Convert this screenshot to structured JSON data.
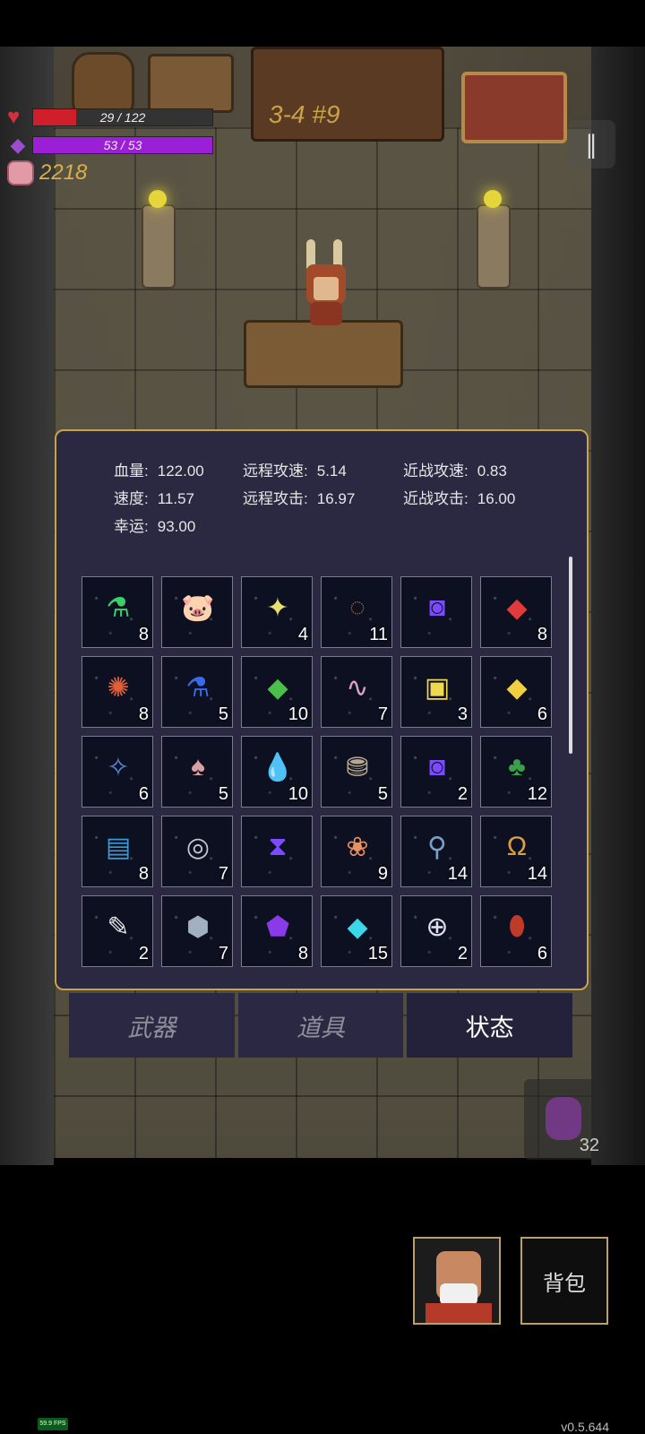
{
  "hud": {
    "hp": {
      "text": "29 / 122",
      "fraction": 0.24,
      "color": "#d01f2a"
    },
    "mana": {
      "text": "53 / 53",
      "fraction": 1.0,
      "color": "#9b1fd6"
    },
    "coins": "2218",
    "level": "3-4 #9"
  },
  "stats": [
    {
      "label": "血量:",
      "value": "122.00"
    },
    {
      "label": "远程攻速:",
      "value": "5.14"
    },
    {
      "label": "近战攻速:",
      "value": "0.83"
    },
    {
      "label": "速度:",
      "value": "11.57"
    },
    {
      "label": "远程攻击:",
      "value": "16.97"
    },
    {
      "label": "近战攻击:",
      "value": "16.00"
    },
    {
      "label": "幸运:",
      "value": "93.00"
    }
  ],
  "items": [
    {
      "icon": "green-potion-icon",
      "glyph": "⚗",
      "color": "#3ad16a",
      "count": "8"
    },
    {
      "icon": "piggy-bank-icon",
      "glyph": "🐷",
      "color": "#f0a0b8",
      "count": ""
    },
    {
      "icon": "star-crystal-icon",
      "glyph": "✦",
      "color": "#e8e070",
      "count": "4"
    },
    {
      "icon": "thorn-ring-icon",
      "glyph": "◌",
      "color": "#9a6a4a",
      "count": "11"
    },
    {
      "icon": "speed-rune-icon",
      "glyph": "◙",
      "color": "#7a4bff",
      "count": ""
    },
    {
      "icon": "red-crystal-icon",
      "glyph": "◆",
      "color": "#e03a3a",
      "count": "8"
    },
    {
      "icon": "spiky-skull-icon",
      "glyph": "✺",
      "color": "#e0603a",
      "count": "8"
    },
    {
      "icon": "blue-potion-icon",
      "glyph": "⚗",
      "color": "#3a6ae8",
      "count": "5"
    },
    {
      "icon": "green-crystal-icon",
      "glyph": "◆",
      "color": "#4ac04a",
      "count": "10"
    },
    {
      "icon": "worm-icon",
      "glyph": "∿",
      "color": "#e0a0c8",
      "count": "7"
    },
    {
      "icon": "yellow-card-icon",
      "glyph": "▣",
      "color": "#f0d850",
      "count": "3"
    },
    {
      "icon": "yellow-crystal-icon",
      "glyph": "◆",
      "color": "#f0d040",
      "count": "6"
    },
    {
      "icon": "dragonfly-icon",
      "glyph": "✧",
      "color": "#5a8ad8",
      "count": "6"
    },
    {
      "icon": "mushroom-icon",
      "glyph": "♠",
      "color": "#d8a0a0",
      "count": "5"
    },
    {
      "icon": "water-drop-icon",
      "glyph": "💧",
      "color": "#3a8ae8",
      "count": "10"
    },
    {
      "icon": "boots-icon",
      "glyph": "⛃",
      "color": "#b8a890",
      "count": "5"
    },
    {
      "icon": "eye-rune-icon",
      "glyph": "◙",
      "color": "#7a4bff",
      "count": "2"
    },
    {
      "icon": "clover-icon",
      "glyph": "♣",
      "color": "#3aa04a",
      "count": "12"
    },
    {
      "icon": "spellbook-icon",
      "glyph": "▤",
      "color": "#3a9ad8",
      "count": "8"
    },
    {
      "icon": "metal-ring-icon",
      "glyph": "◎",
      "color": "#c8c8d0",
      "count": "7"
    },
    {
      "icon": "hourglass-rune-icon",
      "glyph": "⧗",
      "color": "#7a4bff",
      "count": ""
    },
    {
      "icon": "butterfly-icon",
      "glyph": "❀",
      "color": "#e89060",
      "count": "9"
    },
    {
      "icon": "wrench-icon",
      "glyph": "⚲",
      "color": "#7aa0c8",
      "count": "14"
    },
    {
      "icon": "horseshoe-icon",
      "glyph": "Ω",
      "color": "#d8a040",
      "count": "14"
    },
    {
      "icon": "feather-icon",
      "glyph": "✎",
      "color": "#e8e8e8",
      "count": "2"
    },
    {
      "icon": "stone-icon",
      "glyph": "⬢",
      "color": "#a0b0c0",
      "count": "7"
    },
    {
      "icon": "purple-snail-icon",
      "glyph": "⬟",
      "color": "#8a3ae8",
      "count": "8"
    },
    {
      "icon": "cyan-crystal-icon",
      "glyph": "◆",
      "color": "#3ad8e8",
      "count": "15"
    },
    {
      "icon": "cross-ring-icon",
      "glyph": "⊕",
      "color": "#e0e0f0",
      "count": "2"
    },
    {
      "icon": "red-beetle-icon",
      "glyph": "⬮",
      "color": "#c03a2a",
      "count": "6"
    }
  ],
  "tabs": [
    "武器",
    "道具",
    "状态"
  ],
  "active_tab": 2,
  "bottom": {
    "bag_label": "背包",
    "potion_count": "32"
  },
  "fps": "59.9 FPS",
  "version": "v0.5.644"
}
